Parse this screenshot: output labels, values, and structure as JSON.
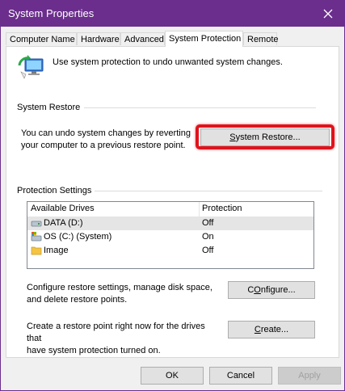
{
  "window": {
    "title": "System Properties"
  },
  "tabs": [
    {
      "label": "Computer Name"
    },
    {
      "label": "Hardware"
    },
    {
      "label": "Advanced"
    },
    {
      "label": "System Protection"
    },
    {
      "label": "Remote"
    }
  ],
  "intro": {
    "text": "Use system protection to undo unwanted system changes."
  },
  "system_restore": {
    "group_label": "System Restore",
    "description_line1": "You can undo system changes by reverting",
    "description_line2": "your computer to a previous restore point.",
    "button_mnemonic": "S",
    "button_rest": "ystem Restore..."
  },
  "protection_settings": {
    "group_label": "Protection Settings",
    "columns": [
      "Available Drives",
      "Protection"
    ],
    "drives": [
      {
        "name": "DATA (D:)",
        "protection": "Off",
        "icon": "drive-icon"
      },
      {
        "name": "OS (C:) (System)",
        "protection": "On",
        "icon": "system-drive-icon"
      },
      {
        "name": "Image",
        "protection": "Off",
        "icon": "folder-icon"
      }
    ],
    "configure_line1": "Configure restore settings, manage disk space,",
    "configure_line2": "and delete restore points.",
    "configure_mnemonic": "O",
    "configure_prefix": "C",
    "configure_rest": "nfigure...",
    "create_line1": "Create a restore point right now for the drives that",
    "create_line2": "have system protection turned on.",
    "create_mnemonic": "C",
    "create_rest": "reate..."
  },
  "footer": {
    "ok": "OK",
    "cancel": "Cancel",
    "apply": "Apply"
  },
  "colors": {
    "titlebar": "#6b2e8c",
    "highlight": "#e0131b"
  }
}
